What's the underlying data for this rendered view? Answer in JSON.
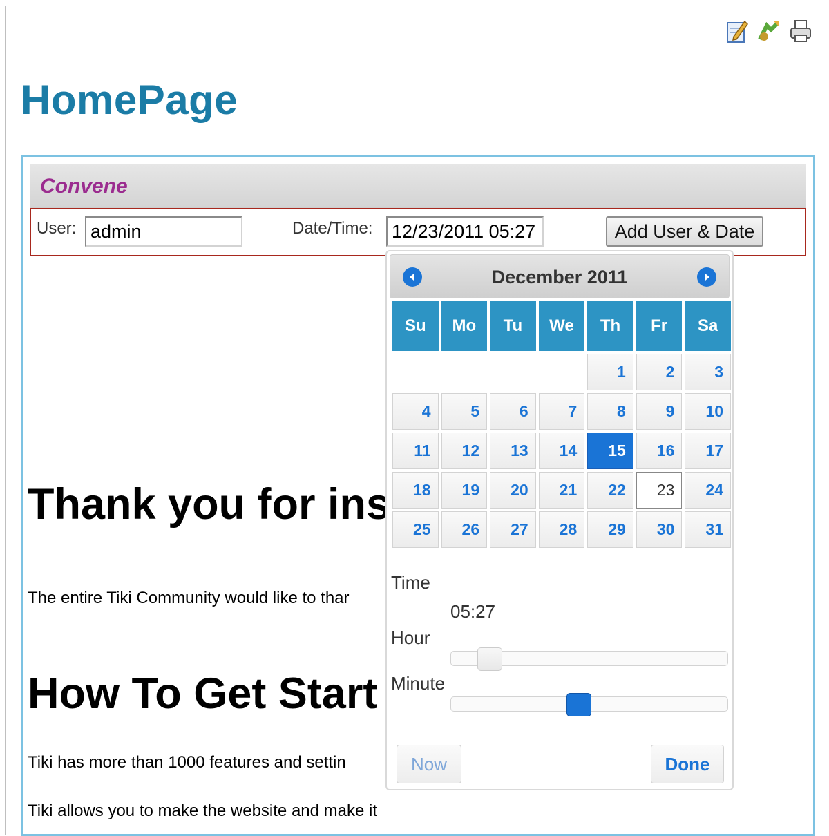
{
  "page": {
    "title": "HomePage"
  },
  "actions": [
    {
      "name": "edit-icon",
      "color": "#4a90d9"
    },
    {
      "name": "translate-icon",
      "color": "#5aa83a"
    },
    {
      "name": "print-icon",
      "color": "#555555"
    }
  ],
  "module": {
    "title": "Convene",
    "user_label": "User:",
    "user_value": "admin",
    "date_label": "Date/Time:",
    "date_value": "12/23/2011 05:27",
    "add_button": "Add User & Date"
  },
  "content": {
    "heading1": "Thank you for ins",
    "para1": "The entire Tiki Community would like to thar",
    "heading2": "How To Get Start",
    "para2": "Tiki has more than 1000 features and settin",
    "para3": "Tiki allows you to make the website and make it"
  },
  "datepicker": {
    "month_title": "December 2011",
    "prev_icon": "arrow-left-icon",
    "next_icon": "arrow-right-icon",
    "weekdays": [
      "Su",
      "Mo",
      "Tu",
      "We",
      "Th",
      "Fr",
      "Sa"
    ],
    "weeks": [
      [
        "",
        "",
        "",
        "",
        "1",
        "2",
        "3"
      ],
      [
        "4",
        "5",
        "6",
        "7",
        "8",
        "9",
        "10"
      ],
      [
        "11",
        "12",
        "13",
        "14",
        "15",
        "16",
        "17"
      ],
      [
        "18",
        "19",
        "20",
        "21",
        "22",
        "23",
        "24"
      ],
      [
        "25",
        "26",
        "27",
        "28",
        "29",
        "30",
        "31"
      ]
    ],
    "selected_day": "15",
    "today_day": "23",
    "time_label": "Time",
    "time_value": "05:27",
    "hour_label": "Hour",
    "minute_label": "Minute",
    "hour_value": 5,
    "minute_value": 27,
    "now_button": "Now",
    "done_button": "Done"
  },
  "colors": {
    "title": "#1b7ca6",
    "module_title": "#9b2c8f",
    "accent": "#1a74d6",
    "weekday_bar": "#2d94c4"
  }
}
